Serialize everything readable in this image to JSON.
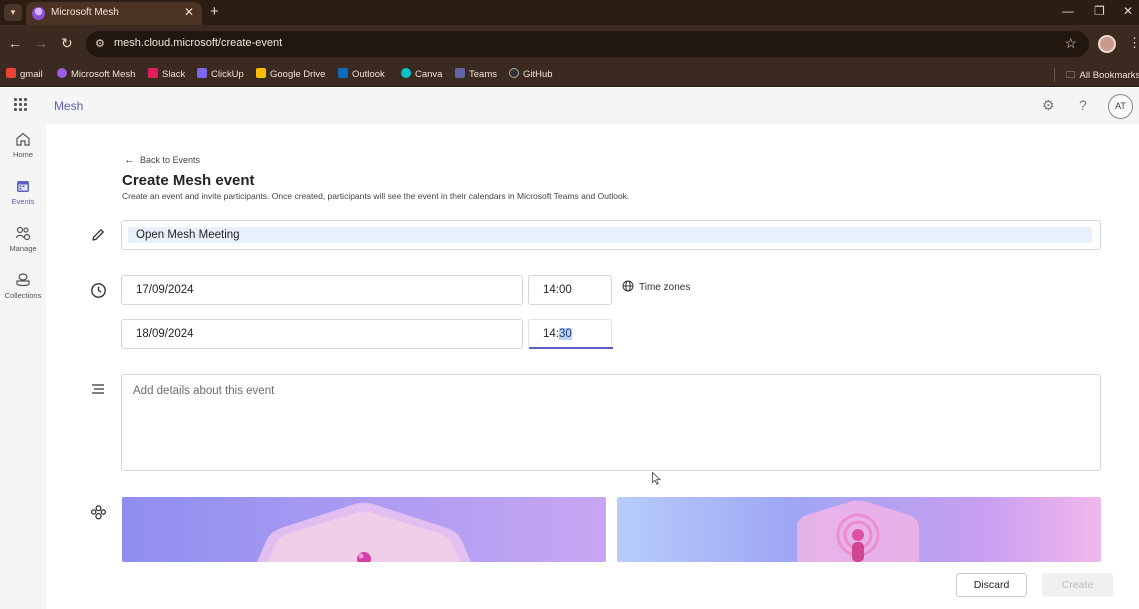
{
  "browser": {
    "tab_title": "Microsoft Mesh",
    "url": "mesh.cloud.microsoft/create-event",
    "bookmarks": [
      {
        "label": "gmail",
        "color": "#ea4335"
      },
      {
        "label": "Microsoft Mesh",
        "color": "#9b5de5"
      },
      {
        "label": "Slack",
        "color": "#e01e5a"
      },
      {
        "label": "ClickUp",
        "color": "#7b68ee"
      },
      {
        "label": "Google Drive",
        "color": "#fbbc04"
      },
      {
        "label": "Outlook",
        "color": "#0f6cbd"
      },
      {
        "label": "Canva",
        "color": "#00c4cc"
      },
      {
        "label": "Teams",
        "color": "#6264a7"
      },
      {
        "label": "GitHub",
        "color": "#333333"
      }
    ],
    "all_bookmarks": "All Bookmarks"
  },
  "app": {
    "title": "Mesh",
    "avatar_initials": "AT",
    "accent": "#5b5fc7"
  },
  "rail": {
    "items": [
      {
        "label": "Home",
        "icon": "home-icon"
      },
      {
        "label": "Events",
        "icon": "calendar-icon"
      },
      {
        "label": "Manage",
        "icon": "manage-icon"
      },
      {
        "label": "Collections",
        "icon": "collections-icon"
      }
    ],
    "active": "Events"
  },
  "page": {
    "back_label": "Back to Events",
    "title": "Create Mesh event",
    "subtitle": "Create an event and invite participants. Once created, participants will see the event in their calendars in Microsoft Teams and Outlook."
  },
  "form": {
    "event_name": "Open Mesh Meeting",
    "start_date": "17/09/2024",
    "start_time": "14:00",
    "end_date": "18/09/2024",
    "end_time_prefix": "14:",
    "end_time_selected": "30",
    "time_zones_label": "Time zones",
    "details_placeholder": "Add details about this event"
  },
  "footer": {
    "discard_label": "Discard",
    "create_label": "Create"
  }
}
